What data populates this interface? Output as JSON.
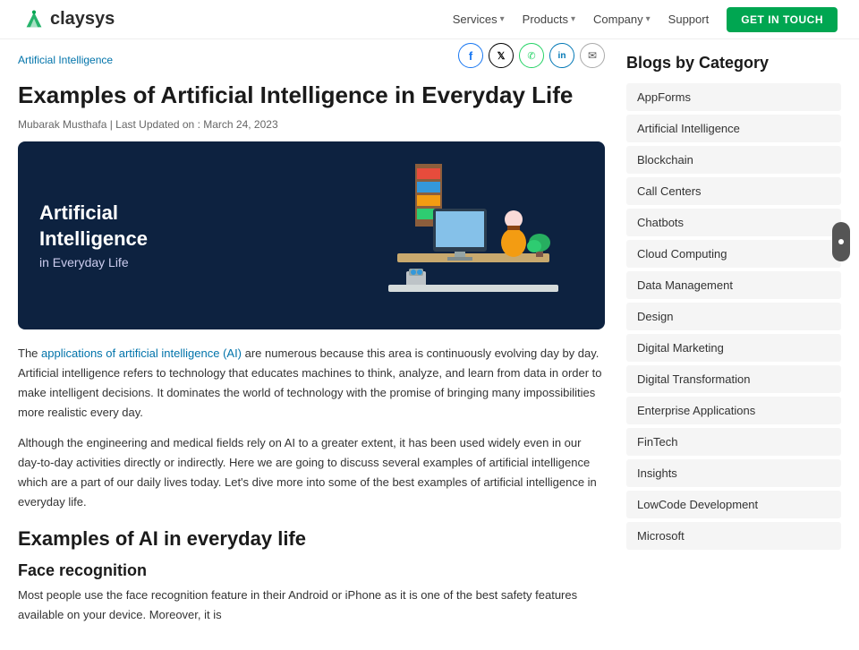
{
  "header": {
    "logo_text": "claysys",
    "nav_items": [
      {
        "label": "Services",
        "has_dropdown": true
      },
      {
        "label": "Products",
        "has_dropdown": true
      },
      {
        "label": "Company",
        "has_dropdown": true
      },
      {
        "label": "Support",
        "has_dropdown": false
      }
    ],
    "cta_label": "GET IN TOUCH"
  },
  "breadcrumb": "Artificial Intelligence",
  "article": {
    "title": "Examples of Artificial Intelligence in Everyday Life",
    "meta": "Mubarak Musthafa | Last Updated on : March 24, 2023",
    "hero": {
      "heading_line1": "Artificial",
      "heading_line2": "Intelligence",
      "subheading": "in Everyday Life"
    },
    "body_paragraphs": [
      "The applications of artificial intelligence (AI) are numerous because this area is continuously evolving day by day. Artificial intelligence refers to technology that educates machines to think, analyze, and learn from data in order to make intelligent decisions. It dominates the world of technology with the promise of bringing many impossibilities more realistic every day.",
      "Although the engineering and medical fields rely on AI to a greater extent, it has been used widely even in our day-to-day activities directly or indirectly. Here we are going to discuss several examples of artificial intelligence which are a part of our daily lives today. Let's dive more into some of the best examples of artificial intelligence in everyday life."
    ],
    "section_heading": "Examples of AI in everyday life",
    "subsection_heading": "Face recognition",
    "subsection_paragraph": "Most people use the face recognition feature in their Android or iPhone as it is one of the best safety features available on your device. Moreover, it is"
  },
  "share_icons": [
    {
      "name": "facebook",
      "symbol": "f"
    },
    {
      "name": "twitter-x",
      "symbol": "𝕏"
    },
    {
      "name": "whatsapp",
      "symbol": "w"
    },
    {
      "name": "linkedin",
      "symbol": "in"
    },
    {
      "name": "email",
      "symbol": "✉"
    }
  ],
  "sidebar": {
    "title": "Blogs by Category",
    "categories": [
      "AppForms",
      "Artificial Intelligence",
      "Blockchain",
      "Call Centers",
      "Chatbots",
      "Cloud Computing",
      "Data Management",
      "Design",
      "Digital Marketing",
      "Digital Transformation",
      "Enterprise Applications",
      "FinTech",
      "Insights",
      "LowCode Development",
      "Microsoft"
    ]
  }
}
